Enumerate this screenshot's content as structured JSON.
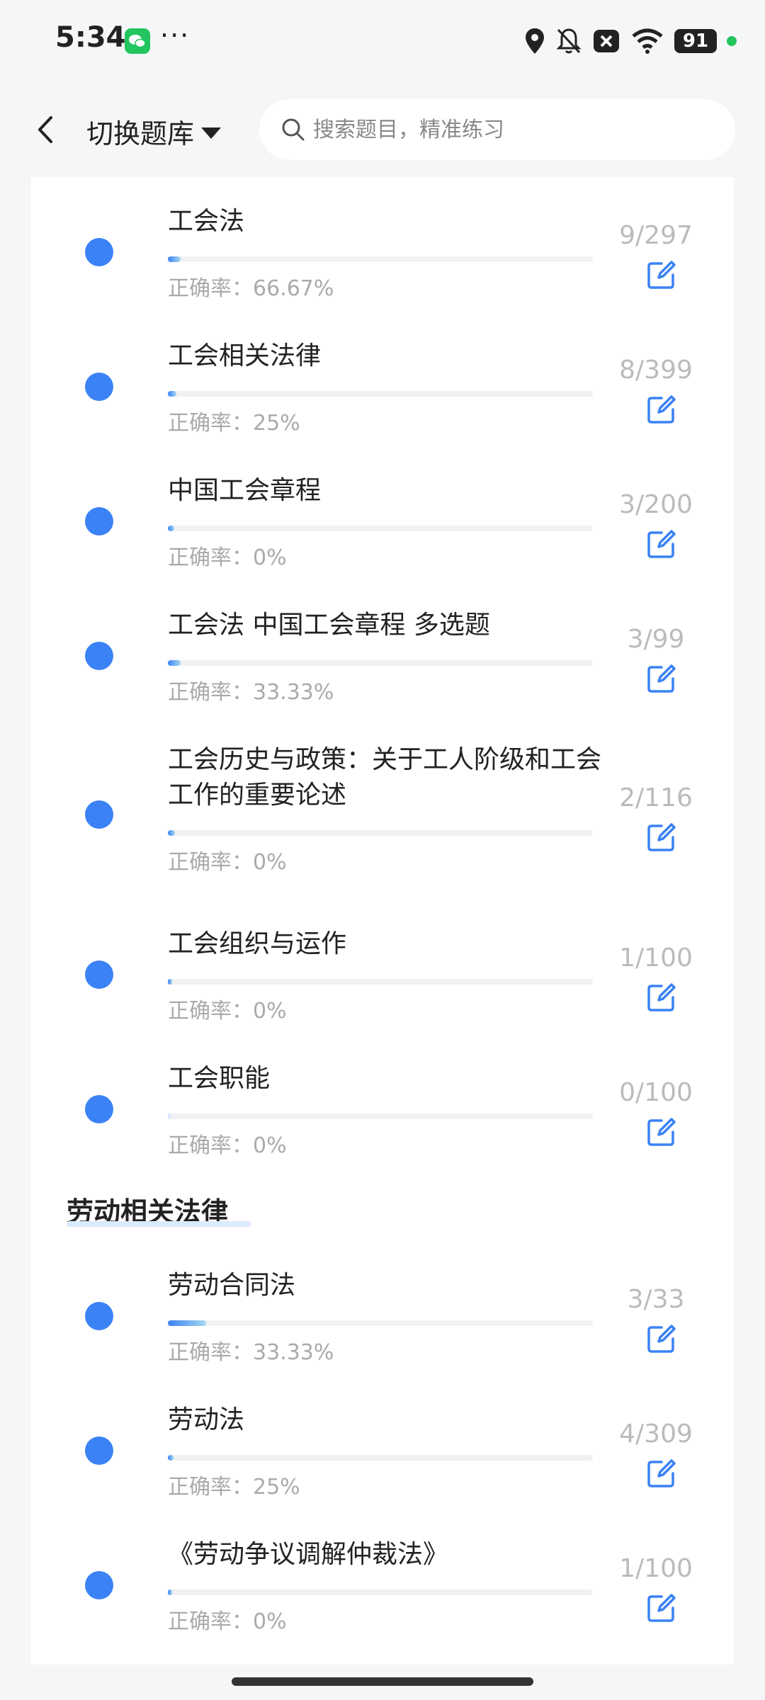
{
  "status_bar": {
    "time": "5:34",
    "dots": "···",
    "battery": "91",
    "icons": [
      "wechat-icon",
      "location-icon",
      "mute-bell-icon",
      "close-box-icon",
      "wifi-icon",
      "battery-icon"
    ]
  },
  "header": {
    "switch_label": "切换题库",
    "search_placeholder": "搜索题目，精准练习"
  },
  "accuracy_label": "正确率：",
  "chapters": [
    {
      "title": "工会法",
      "accuracy": "66.67%",
      "count": "9/297",
      "progress": 0.03
    },
    {
      "title": "工会相关法律",
      "accuracy": "25%",
      "count": "8/399",
      "progress": 0.02
    },
    {
      "title": "中国工会章程",
      "accuracy": "0%",
      "count": "3/200",
      "progress": 0.015
    },
    {
      "title": "工会法 中国工会章程 多选题",
      "accuracy": "33.33%",
      "count": "3/99",
      "progress": 0.03
    },
    {
      "title": "工会历史与政策：关于工人阶级和工会工作的重要论述",
      "accuracy": "0%",
      "count": "2/116",
      "progress": 0.017
    },
    {
      "title": "工会组织与运作",
      "accuracy": "0%",
      "count": "1/100",
      "progress": 0.01
    },
    {
      "title": "工会职能",
      "accuracy": "0%",
      "count": "0/100",
      "progress": 0.0
    }
  ],
  "section2": {
    "title": "劳动相关法律",
    "chapters": [
      {
        "title": "劳动合同法",
        "accuracy": "33.33%",
        "count": "3/33",
        "progress": 0.09
      },
      {
        "title": "劳动法",
        "accuracy": "25%",
        "count": "4/309",
        "progress": 0.013
      },
      {
        "title": "《劳动争议调解仲裁法》",
        "accuracy": "0%",
        "count": "1/100",
        "progress": 0.01
      }
    ]
  },
  "colors": {
    "accent": "#3b82f6",
    "muted_text": "#aaaaaa",
    "count_text": "#bbbbbb"
  }
}
